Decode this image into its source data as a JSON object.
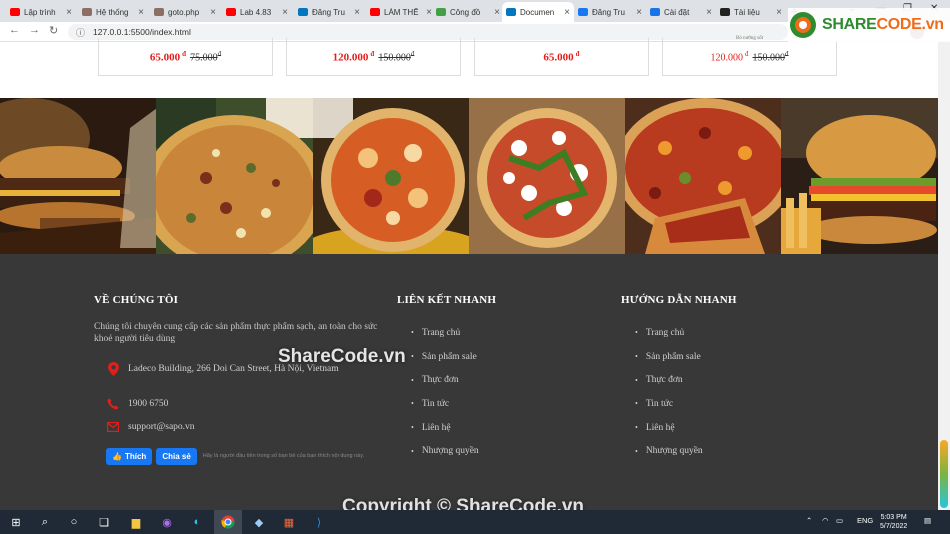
{
  "browser": {
    "tabs": [
      {
        "title": "Lập trình",
        "favicon": "youtube-icon",
        "color": "#ff0000",
        "active": false
      },
      {
        "title": "Hệ thống",
        "favicon": "page-icon",
        "color": "#8d6e63",
        "active": false
      },
      {
        "title": "goto.php",
        "favicon": "page-icon",
        "color": "#8d6e63",
        "active": false
      },
      {
        "title": "Lab 4.83",
        "favicon": "youtube-icon",
        "color": "#ff0000",
        "active": false
      },
      {
        "title": "Đăng Tru",
        "favicon": "app-icon",
        "color": "#0277bd",
        "active": false
      },
      {
        "title": "LÀM THẾ",
        "favicon": "youtube-icon",
        "color": "#ff0000",
        "active": false
      },
      {
        "title": "Công đồ",
        "favicon": "leaf-icon",
        "color": "#43a047",
        "active": false
      },
      {
        "title": "Documen",
        "favicon": "app-icon",
        "color": "#0277bd",
        "active": true
      },
      {
        "title": "Đăng Tru",
        "favicon": "facebook-icon",
        "color": "#1877f2",
        "active": false
      },
      {
        "title": "Cài đặt",
        "favicon": "gear-icon",
        "color": "#1a73e8",
        "active": false
      },
      {
        "title": "Tài liệu",
        "favicon": "github-icon",
        "color": "#222222",
        "active": false
      }
    ],
    "new_tab": "+",
    "url": "127.0.0.1:5500/index.html"
  },
  "products": [
    {
      "price": "65.000",
      "currency": "đ",
      "old_price": "75.000"
    },
    {
      "price": "120.000",
      "currency": "đ",
      "old_price": "150.000"
    },
    {
      "price": "65.000",
      "currency": "đ",
      "old_price": ""
    },
    {
      "price": "120.000",
      "currency": "đ",
      "old_price": "150.000",
      "note": "Bò nướng sốt"
    }
  ],
  "food_images": [
    {
      "name": "burger-photo",
      "base": "#3b2314"
    },
    {
      "name": "pizza-photo-1",
      "base": "#6b4b2a"
    },
    {
      "name": "pizza-photo-2",
      "base": "#8a5a2b"
    },
    {
      "name": "pizza-photo-3",
      "base": "#a97b4d"
    },
    {
      "name": "pizza-photo-4",
      "base": "#5a3a28"
    },
    {
      "name": "burger-photo-2",
      "base": "#4a2e1c"
    }
  ],
  "footer": {
    "about": {
      "heading": "VỀ CHÚNG TÔI",
      "text": "Chúng tôi chuyên cung cấp các sản phẩm thực phẩm sạch, an toàn cho sức khoẻ người tiêu dùng",
      "address": "Ladeco Building, 266 Doi Can Street, Hà Nội, Vietnam",
      "phone": "1900 6750",
      "email": "support@sapo.vn",
      "like_label": "Thích",
      "share_label": "Chia sẻ",
      "fb_note": "Hãy là người đầu tiên trong số bạn bè của bạn thích nội dung này."
    },
    "quick_links": {
      "heading": "LIÊN KẾT NHANH",
      "items": [
        "Trang chủ",
        "Sản phẩm sale",
        "Thực đơn",
        "Tin tức",
        "Liên hệ",
        "Nhượng quyền"
      ]
    },
    "quick_guide": {
      "heading": "HƯỚNG DẪN NHANH",
      "items": [
        "Trang chủ",
        "Sản phẩm sale",
        "Thực đơn",
        "Tin tức",
        "Liên hệ",
        "Nhượng quyền"
      ]
    },
    "accent_color": "#e31d1a"
  },
  "watermark": {
    "center": "ShareCode.vn",
    "bottom": "Copyright © ShareCode.vn",
    "logo": "SHARECODE.vn"
  },
  "taskbar": {
    "lang": "ENG",
    "time": "5:03 PM",
    "date": "5/7/2022"
  }
}
